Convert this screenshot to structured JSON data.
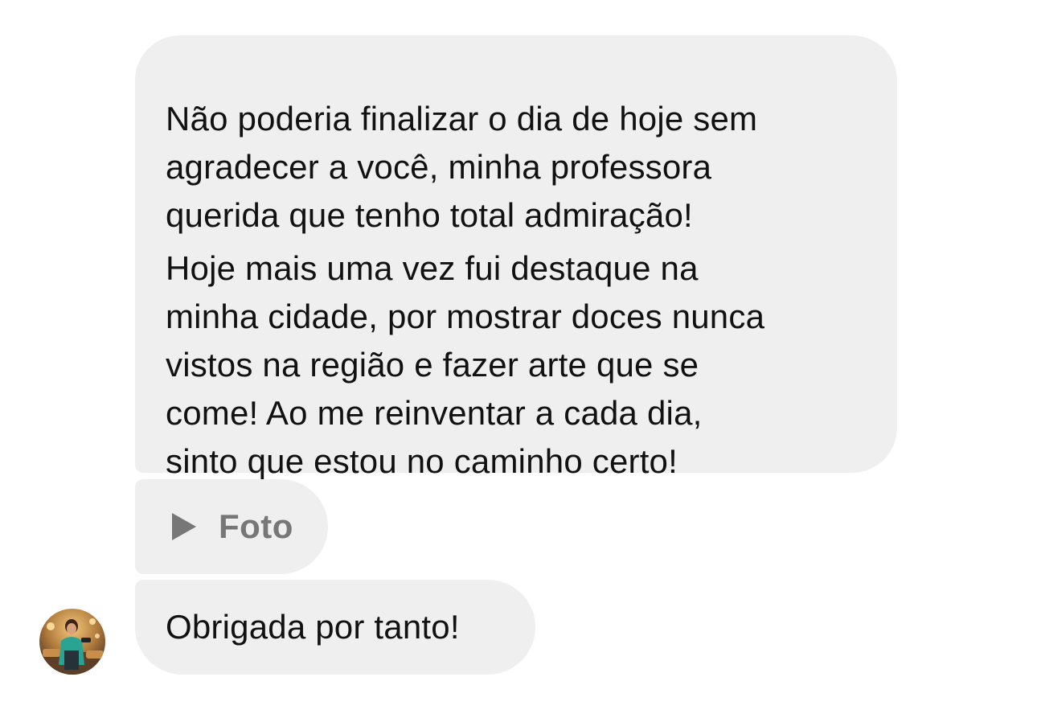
{
  "messages": [
    {
      "paragraphs": [
        "Não poderia finalizar o dia de hoje sem\nagradecer a você, minha professora\nquerida que tenho total admiração!",
        "Hoje mais uma vez fui destaque na\nminha cidade, por mostrar doces nunca\nvistos na região e fazer arte que se\ncome! Ao me reinventar a cada dia,\nsinto que estou no caminho certo!"
      ]
    },
    {
      "attachment": {
        "icon": "play-icon",
        "label": "Foto"
      }
    },
    {
      "text": "Obrigada por tanto!"
    }
  ],
  "avatar": {
    "icon": "avatar-photo"
  },
  "colors": {
    "bubble": "#efefef",
    "text": "#111111",
    "attachment_text": "#777777"
  }
}
